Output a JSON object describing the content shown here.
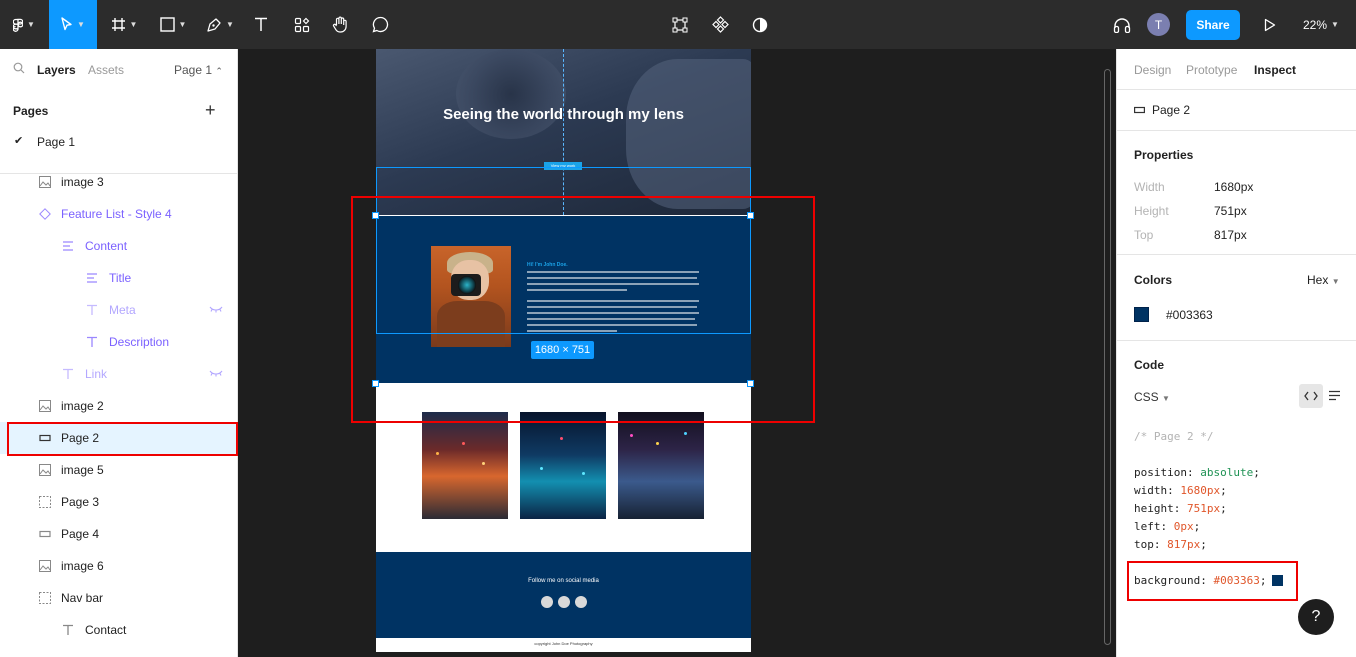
{
  "toolbar": {
    "avatar_initial": "T",
    "share_label": "Share",
    "zoom_label": "22%"
  },
  "left_panel": {
    "tabs": {
      "layers": "Layers",
      "assets": "Assets",
      "page": "Page 1"
    },
    "pages_heading": "Pages",
    "pages": [
      {
        "label": "Page 1",
        "checked": true
      }
    ],
    "layers": [
      {
        "label": "image 3"
      },
      {
        "label": "Feature List - Style 4"
      },
      {
        "label": "Content"
      },
      {
        "label": "Title"
      },
      {
        "label": "Meta"
      },
      {
        "label": "Description"
      },
      {
        "label": "Link"
      },
      {
        "label": "image 2"
      },
      {
        "label": "Page 2",
        "selected": true
      },
      {
        "label": "image 5"
      },
      {
        "label": "Page 3"
      },
      {
        "label": "Page 4"
      },
      {
        "label": "image 6"
      },
      {
        "label": "Nav bar"
      },
      {
        "label": "Contact"
      }
    ]
  },
  "canvas": {
    "hero_title": "Seeing the world through my lens",
    "hero_button": "View my work",
    "about_name": "Hi! I'm John Doe.",
    "dimension_badge": "1680 × 751",
    "social_title": "Follow me on social media",
    "footer_text": "copyright John Doe Photography"
  },
  "right_panel": {
    "tabs": {
      "design": "Design",
      "prototype": "Prototype",
      "inspect": "Inspect"
    },
    "layer_name": "Page 2",
    "properties_heading": "Properties",
    "properties": [
      {
        "key": "Width",
        "value": "1680px"
      },
      {
        "key": "Height",
        "value": "751px"
      },
      {
        "key": "Top",
        "value": "817px"
      }
    ],
    "colors_heading": "Colors",
    "color_format": "Hex",
    "color_value": "#003363",
    "code_heading": "Code",
    "code_lang": "CSS",
    "code_comment": "/* Page 2 */",
    "code": [
      {
        "prop": "position",
        "value": "absolute"
      },
      {
        "prop": "width",
        "value": "1680px"
      },
      {
        "prop": "height",
        "value": "751px"
      },
      {
        "prop": "left",
        "value": "0px"
      },
      {
        "prop": "top",
        "value": "817px"
      }
    ],
    "background_prop": "background",
    "background_value": "#003363",
    "help_label": "?"
  },
  "colors": {
    "accent": "#0d99ff",
    "highlight": "#e00000",
    "frame_bg": "#003363"
  }
}
